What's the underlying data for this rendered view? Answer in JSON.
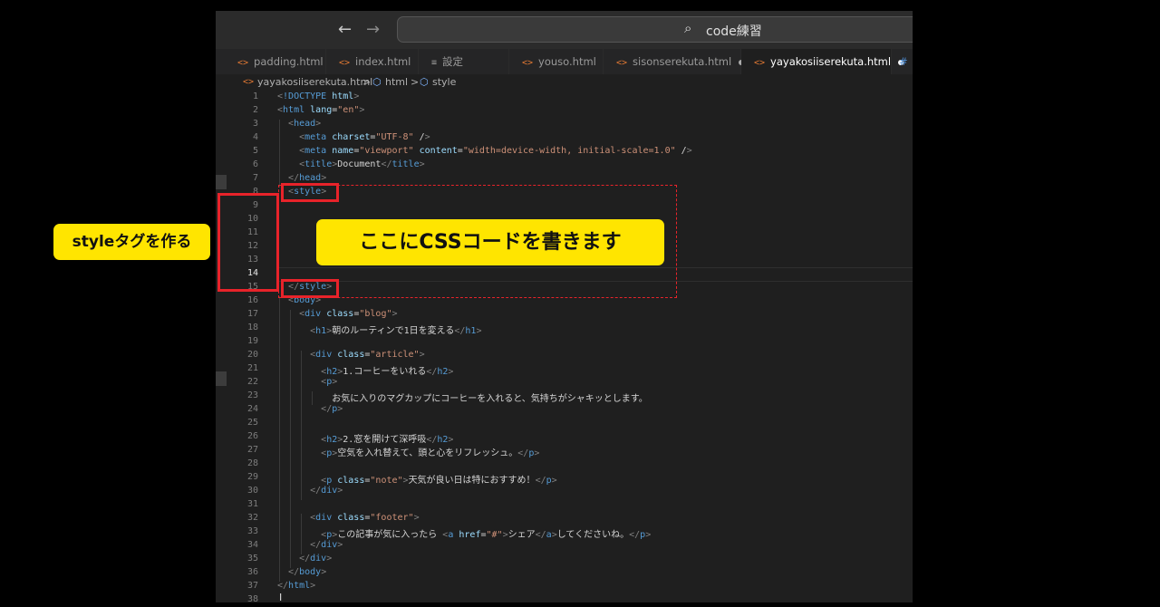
{
  "titlebar": {
    "back": "←",
    "forward": "→",
    "search_icon": "⌕",
    "search_text": "code練習"
  },
  "tabs": [
    {
      "label": "padding.html",
      "icon": "<>",
      "dirty": false,
      "active": false
    },
    {
      "label": "index.html",
      "icon": "<>",
      "dirty": false,
      "active": false
    },
    {
      "label": "設定",
      "icon": "≡",
      "dirty": false,
      "active": false
    },
    {
      "label": "youso.html",
      "icon": "<>",
      "dirty": false,
      "active": false
    },
    {
      "label": "sisonserekuta.html",
      "icon": "<>",
      "dirty": true,
      "active": false
    },
    {
      "label": "yayakosiiserekuta.html",
      "icon": "<>",
      "dirty": true,
      "active": true
    },
    {
      "label": "#",
      "icon": "",
      "dirty": false,
      "active": false
    }
  ],
  "breadcrumb": {
    "file": "yayakosiiserekuta.html",
    "sep": ">",
    "item1": "html",
    "item2": "style",
    "file_icon": "<>",
    "sym_icon": "⬡"
  },
  "code_lines": [
    {
      "n": "1",
      "t": "<!DOCTYPE html>"
    },
    {
      "n": "2",
      "t": "<html lang=\"en\">"
    },
    {
      "n": "3",
      "t": "  <head>"
    },
    {
      "n": "4",
      "t": "    <meta charset=\"UTF-8\" />"
    },
    {
      "n": "5",
      "t": "    <meta name=\"viewport\" content=\"width=device-width, initial-scale=1.0\" />"
    },
    {
      "n": "6",
      "t": "    <title>Document</title>"
    },
    {
      "n": "7",
      "t": "  </head>"
    },
    {
      "n": "8",
      "t": "  <style>"
    },
    {
      "n": "9",
      "t": ""
    },
    {
      "n": "10",
      "t": ""
    },
    {
      "n": "11",
      "t": ""
    },
    {
      "n": "12",
      "t": ""
    },
    {
      "n": "13",
      "t": ""
    },
    {
      "n": "14",
      "t": ""
    },
    {
      "n": "15",
      "t": "  </style>"
    },
    {
      "n": "16",
      "t": "  <body>"
    },
    {
      "n": "17",
      "t": "    <div class=\"blog\">"
    },
    {
      "n": "18",
      "t": "      <h1>朝のルーティンで1日を変える</h1>"
    },
    {
      "n": "19",
      "t": ""
    },
    {
      "n": "20",
      "t": "      <div class=\"article\">"
    },
    {
      "n": "21",
      "t": "        <h2>1.コーヒーをいれる</h2>"
    },
    {
      "n": "22",
      "t": "        <p>"
    },
    {
      "n": "23",
      "t": "          お気に入りのマグカップにコーヒーを入れると、気持ちがシャキッとします。"
    },
    {
      "n": "24",
      "t": "        </p>"
    },
    {
      "n": "25",
      "t": ""
    },
    {
      "n": "26",
      "t": "        <h2>2.窓を開けて深呼吸</h2>"
    },
    {
      "n": "27",
      "t": "        <p>空気を入れ替えて、頭と心をリフレッシュ。</p>"
    },
    {
      "n": "28",
      "t": ""
    },
    {
      "n": "29",
      "t": "        <p class=\"note\">天気が良い日は特におすすめ！</p>"
    },
    {
      "n": "30",
      "t": "      </div>"
    },
    {
      "n": "31",
      "t": ""
    },
    {
      "n": "32",
      "t": "      <div class=\"footer\">"
    },
    {
      "n": "33",
      "t": "        <p>この記事が気に入ったら <a href=\"#\">シェア</a>してくださいね。</p>"
    },
    {
      "n": "34",
      "t": "      </div>"
    },
    {
      "n": "35",
      "t": "    </div>"
    },
    {
      "n": "36",
      "t": "  </body>"
    },
    {
      "n": "37",
      "t": "</html>"
    },
    {
      "n": "38",
      "t": ""
    }
  ],
  "current_line": "14",
  "annotations": {
    "left_label": "styleタグを作る",
    "center_label": "ここにCSSコードを書きます"
  },
  "colors": {
    "accent_red": "#e8232a",
    "label_yellow": "#ffe500",
    "editor_bg": "#1f1f1f"
  }
}
